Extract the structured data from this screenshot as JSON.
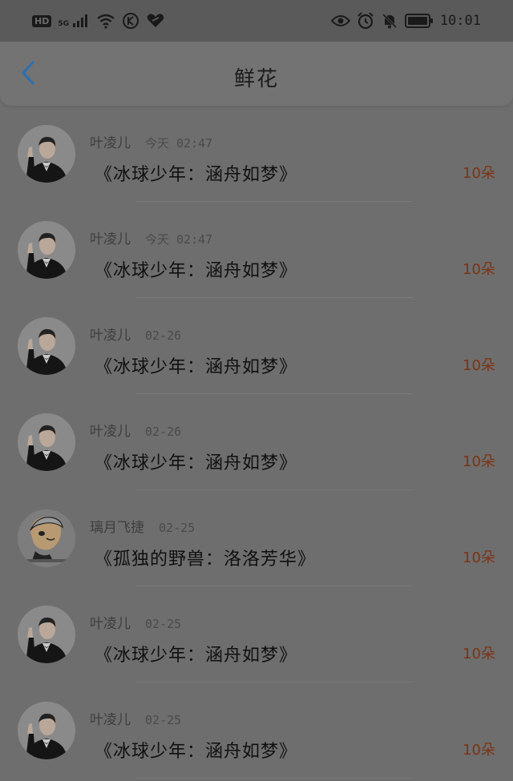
{
  "status_bar": {
    "hd": "HD",
    "network": "5G",
    "time": "10:01"
  },
  "header": {
    "title": "鲜花"
  },
  "items": [
    {
      "user": "叶凌儿",
      "time": "今天 02:47",
      "work": "《冰球少年：涵舟如梦》",
      "count": "10朵",
      "avatar": "man-in-tuxedo"
    },
    {
      "user": "叶凌儿",
      "time": "今天 02:47",
      "work": "《冰球少年：涵舟如梦》",
      "count": "10朵",
      "avatar": "man-in-tuxedo"
    },
    {
      "user": "叶凌儿",
      "time": "02-26",
      "work": "《冰球少年：涵舟如梦》",
      "count": "10朵",
      "avatar": "man-in-tuxedo"
    },
    {
      "user": "叶凌儿",
      "time": "02-26",
      "work": "《冰球少年：涵舟如梦》",
      "count": "10朵",
      "avatar": "man-in-tuxedo"
    },
    {
      "user": "璃月飞捷",
      "time": "02-25",
      "work": "《孤独的野兽：洛洛芳华》",
      "count": "10朵",
      "avatar": "cartoon-face"
    },
    {
      "user": "叶凌儿",
      "time": "02-25",
      "work": "《冰球少年：涵舟如梦》",
      "count": "10朵",
      "avatar": "man-in-tuxedo"
    },
    {
      "user": "叶凌儿",
      "time": "02-25",
      "work": "《冰球少年：涵舟如梦》",
      "count": "10朵",
      "avatar": "man-in-tuxedo"
    }
  ],
  "colors": {
    "count": "#7a3414",
    "back_arrow": "#2a6fb0"
  }
}
